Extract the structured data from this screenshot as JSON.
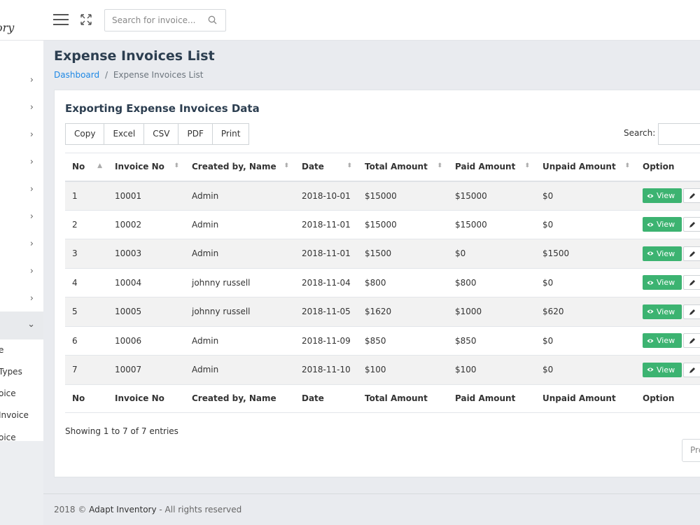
{
  "brand": {
    "text": "ory"
  },
  "sidebar": {
    "submenu": [
      "e",
      " Types",
      "oice",
      " Invoice",
      "oice"
    ]
  },
  "topbar": {
    "search_placeholder": "Search for invoice..."
  },
  "header": {
    "title": "Expense Invoices List",
    "breadcrumb_home": "Dashboard",
    "breadcrumb_sep": "/",
    "breadcrumb_current": "Expense Invoices List"
  },
  "card": {
    "title": "Exporting Expense Invoices Data",
    "buttons": [
      "Copy",
      "Excel",
      "CSV",
      "PDF",
      "Print"
    ],
    "search_label": "Search:",
    "columns": [
      "No",
      "Invoice No",
      "Created by, Name",
      "Date",
      "Total Amount",
      "Paid Amount",
      "Unpaid Amount",
      "Option"
    ],
    "rows": [
      [
        "1",
        "10001",
        "Admin",
        "2018-10-01",
        "$15000",
        "$15000",
        "$0"
      ],
      [
        "2",
        "10002",
        "Admin",
        "2018-11-01",
        "$15000",
        "$15000",
        "$0"
      ],
      [
        "3",
        "10003",
        "Admin",
        "2018-11-01",
        "$1500",
        "$0",
        "$1500"
      ],
      [
        "4",
        "10004",
        "johnny russell",
        "2018-11-04",
        "$800",
        "$800",
        "$0"
      ],
      [
        "5",
        "10005",
        "johnny russell",
        "2018-11-05",
        "$1620",
        "$1000",
        "$620"
      ],
      [
        "6",
        "10006",
        "Admin",
        "2018-11-09",
        "$850",
        "$850",
        "$0"
      ],
      [
        "7",
        "10007",
        "Admin",
        "2018-11-10",
        "$100",
        "$100",
        "$0"
      ]
    ],
    "view_label": "View",
    "info": "Showing 1 to 7 of 7 entries",
    "prev_label": "Pre"
  },
  "footer": {
    "prefix": "2018 © ",
    "brand": "Adapt Inventory",
    "suffix": " - All rights reserved"
  },
  "colors": {
    "view_button": "#3cb371",
    "link": "#1e88e5",
    "title": "#2c3e50"
  }
}
